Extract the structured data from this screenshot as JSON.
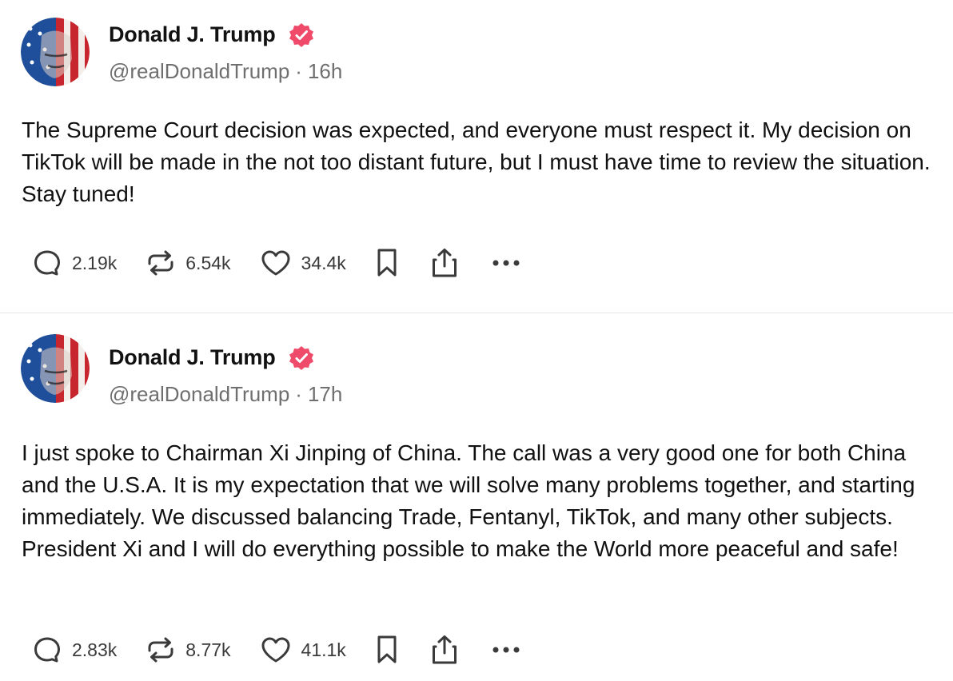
{
  "colors": {
    "verified_badge": "#f04a6b",
    "text": "#111111",
    "muted": "#6f6f6f",
    "divider": "#e6e6e6"
  },
  "posts": [
    {
      "author": {
        "name": "Donald J. Trump",
        "handle": "@realDonaldTrump",
        "verified_icon": "verified-badge-icon"
      },
      "separator": "·",
      "time": "16h",
      "text": "The Supreme Court decision was expected, and everyone must respect it. My decision on TikTok will be made in the not too distant future, but I must have time to review the situation. Stay tuned!",
      "actions": {
        "replies": "2.19k",
        "reposts": "6.54k",
        "likes": "34.4k"
      }
    },
    {
      "author": {
        "name": "Donald J. Trump",
        "handle": "@realDonaldTrump",
        "verified_icon": "verified-badge-icon"
      },
      "separator": "·",
      "time": "17h",
      "text": "I just spoke to Chairman Xi Jinping of China. The call was a very good one for both China and the U.S.A. It is my expectation that we will solve many problems together, and starting immediately. We discussed balancing Trade, Fentanyl, TikTok, and many other subjects. President Xi and I will do everything possible to make the World more peaceful and safe!",
      "actions": {
        "replies": "2.83k",
        "reposts": "8.77k",
        "likes": "41.1k"
      }
    }
  ]
}
